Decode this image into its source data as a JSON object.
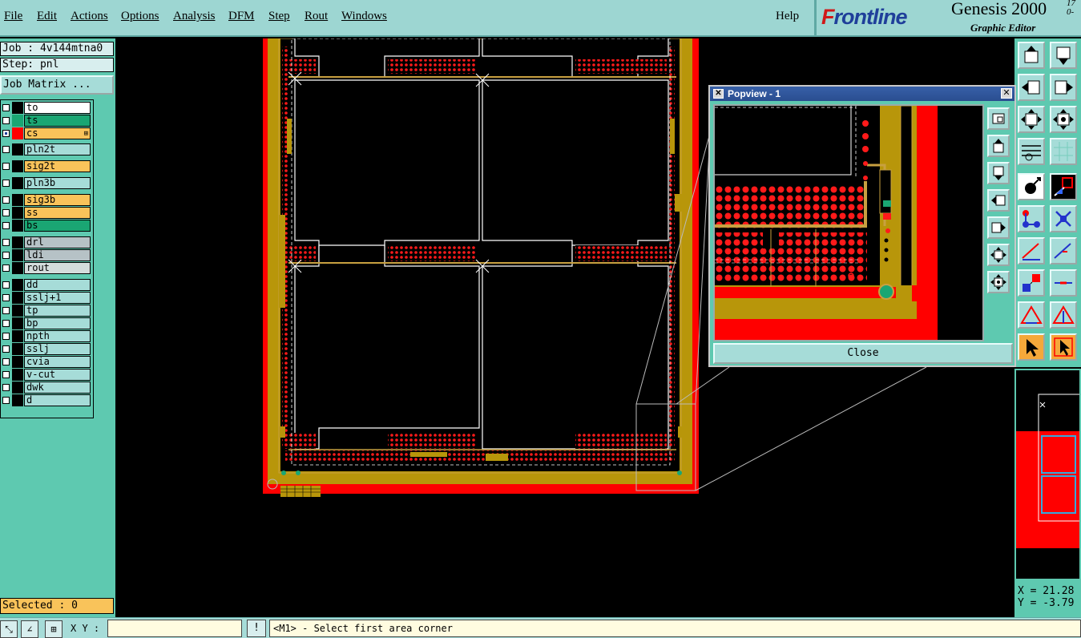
{
  "menu": {
    "items": [
      "File",
      "Edit",
      "Actions",
      "Options",
      "Analysis",
      "DFM",
      "Step",
      "Rout",
      "Windows"
    ],
    "help": "Help"
  },
  "brand": {
    "logo_prefix": "F",
    "logo_rest": "rontline",
    "title": "Genesis 2000",
    "subtitle": "Graphic Editor",
    "version_line1": "17",
    "version_line2": "0-"
  },
  "job": {
    "job_line": "Job : 4v144mtna0",
    "step_line": "Step: pnl",
    "matrix_button": "Job Matrix ..."
  },
  "layers": [
    {
      "name": "to",
      "bg": "#ffffff",
      "swatch": "#000000"
    },
    {
      "name": "ts",
      "bg": "#1aa673",
      "swatch": "#1aa673"
    },
    {
      "name": "cs",
      "bg": "#f9c35a",
      "swatch": "#ff0000",
      "dash": true,
      "active": true
    },
    {
      "name": "pln2t",
      "bg": "#a6dcd8",
      "swatch": "#000000"
    },
    {
      "name": "sig2t",
      "bg": "#f9c35a",
      "swatch": "#000000"
    },
    {
      "name": "pln3b",
      "bg": "#a6dcd8",
      "swatch": "#000000"
    },
    {
      "name": "sig3b",
      "bg": "#f9c35a",
      "swatch": "#000000"
    },
    {
      "name": "ss",
      "bg": "#f9c35a",
      "swatch": "#000000"
    },
    {
      "name": "bs",
      "bg": "#1aa673",
      "swatch": "#000000"
    },
    {
      "name": "drl",
      "bg": "#b6c2c6",
      "swatch": "#000000"
    },
    {
      "name": "ldi",
      "bg": "#b6c2c6",
      "swatch": "#000000"
    },
    {
      "name": "rout",
      "bg": "#d4dcdc",
      "swatch": "#000000"
    },
    {
      "name": "dd",
      "bg": "#a6dcd8",
      "swatch": "#000000"
    },
    {
      "name": "sslj+1",
      "bg": "#a6dcd8",
      "swatch": "#000000"
    },
    {
      "name": "tp",
      "bg": "#a6dcd8",
      "swatch": "#000000"
    },
    {
      "name": "bp",
      "bg": "#a6dcd8",
      "swatch": "#000000"
    },
    {
      "name": "npth",
      "bg": "#a6dcd8",
      "swatch": "#000000"
    },
    {
      "name": "sslj",
      "bg": "#a6dcd8",
      "swatch": "#000000"
    },
    {
      "name": "cvia",
      "bg": "#a6dcd8",
      "swatch": "#000000"
    },
    {
      "name": "v-cut",
      "bg": "#a6dcd8",
      "swatch": "#000000"
    },
    {
      "name": "dwk",
      "bg": "#a6dcd8",
      "swatch": "#000000"
    },
    {
      "name": "d",
      "bg": "#a6dcd8",
      "swatch": "#000000"
    }
  ],
  "selected": "Selected : 0",
  "status": {
    "xy_label": "X Y :",
    "xy_value": "",
    "prompt_glyph": "!",
    "message": "<M1> - Select first area corner"
  },
  "coords": {
    "x": "X = 21.28",
    "y": "Y = -3.79"
  },
  "popview": {
    "title": "Popview - 1",
    "close_label": "Close"
  },
  "colors": {
    "panel": "#5ec9b0",
    "menubar": "#9dd6d2",
    "copper_red": "#ff0000",
    "copper_gold": "#b8960a",
    "outline_white": "#ffffff"
  }
}
